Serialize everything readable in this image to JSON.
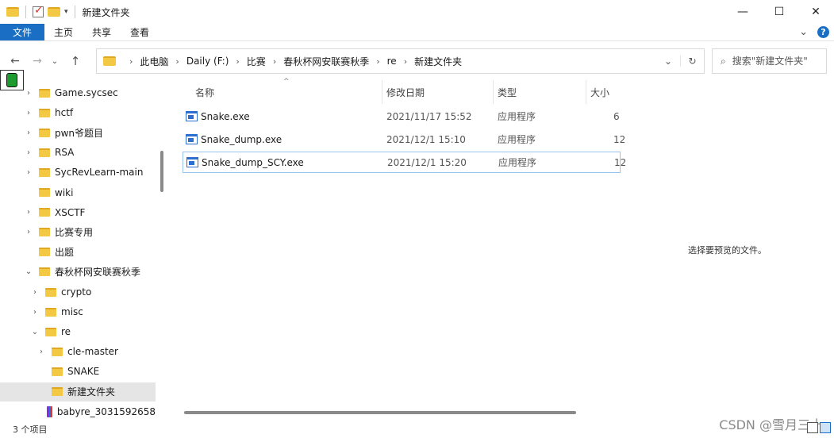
{
  "window": {
    "title": "新建文件夹",
    "controls": {
      "minimize": "—",
      "maximize": "☐",
      "close": "✕"
    }
  },
  "ribbon": {
    "tabs": [
      "文件",
      "主页",
      "共享",
      "查看"
    ],
    "expand": "⌄",
    "help": "?"
  },
  "nav_buttons": {
    "back": "←",
    "forward": "→",
    "recent": "⌄",
    "up": "↑"
  },
  "address": {
    "crumbs": [
      "此电脑",
      "Daily (F:)",
      "比赛",
      "春秋杯网安联赛秋季",
      "re",
      "新建文件夹"
    ],
    "dropdown": "⌄",
    "refresh": "↻"
  },
  "search": {
    "placeholder": "搜索\"新建文件夹\""
  },
  "nav_tree": [
    {
      "label": "Game.sycsec",
      "expander": "›",
      "indent": 0,
      "icon": "folder"
    },
    {
      "label": "hctf",
      "expander": "›",
      "indent": 0,
      "icon": "folder"
    },
    {
      "label": "pwn爷题目",
      "expander": "›",
      "indent": 0,
      "icon": "folder"
    },
    {
      "label": "RSA",
      "expander": "›",
      "indent": 0,
      "icon": "folder"
    },
    {
      "label": "SycRevLearn-main",
      "expander": "›",
      "indent": 0,
      "icon": "folder"
    },
    {
      "label": "wiki",
      "expander": "",
      "indent": 0,
      "icon": "folder"
    },
    {
      "label": "XSCTF",
      "expander": "›",
      "indent": 0,
      "icon": "folder"
    },
    {
      "label": "比赛专用",
      "expander": "›",
      "indent": 0,
      "icon": "folder"
    },
    {
      "label": "出题",
      "expander": "",
      "indent": 0,
      "icon": "folder"
    },
    {
      "label": "春秋杯网安联赛秋季",
      "expander": "⌄",
      "indent": 0,
      "icon": "folder"
    },
    {
      "label": "crypto",
      "expander": "›",
      "indent": 1,
      "icon": "folder"
    },
    {
      "label": "misc",
      "expander": "›",
      "indent": 1,
      "icon": "folder"
    },
    {
      "label": "re",
      "expander": "⌄",
      "indent": 1,
      "icon": "folder"
    },
    {
      "label": "cle-master",
      "expander": "›",
      "indent": 2,
      "icon": "folder"
    },
    {
      "label": "SNAKE",
      "expander": "",
      "indent": 2,
      "icon": "folder"
    },
    {
      "label": "新建文件夹",
      "expander": "",
      "indent": 2,
      "icon": "folder",
      "selected": true
    },
    {
      "label": "babyre_3031592658",
      "expander": "",
      "indent": 2,
      "icon": "rar"
    }
  ],
  "columns": [
    "名称",
    "修改日期",
    "类型",
    "大小"
  ],
  "sort_indicator": "^",
  "files": [
    {
      "name": "Snake.exe",
      "modified": "2021/11/17 15:52",
      "type": "应用程序",
      "size": "6"
    },
    {
      "name": "Snake_dump.exe",
      "modified": "2021/12/1 15:10",
      "type": "应用程序",
      "size": "12"
    },
    {
      "name": "Snake_dump_SCY.exe",
      "modified": "2021/12/1 15:20",
      "type": "应用程序",
      "size": "12"
    }
  ],
  "preview": {
    "message": "选择要预览的文件。"
  },
  "status": {
    "count": "3 个项目"
  },
  "watermark": "CSDN @雪月三十"
}
